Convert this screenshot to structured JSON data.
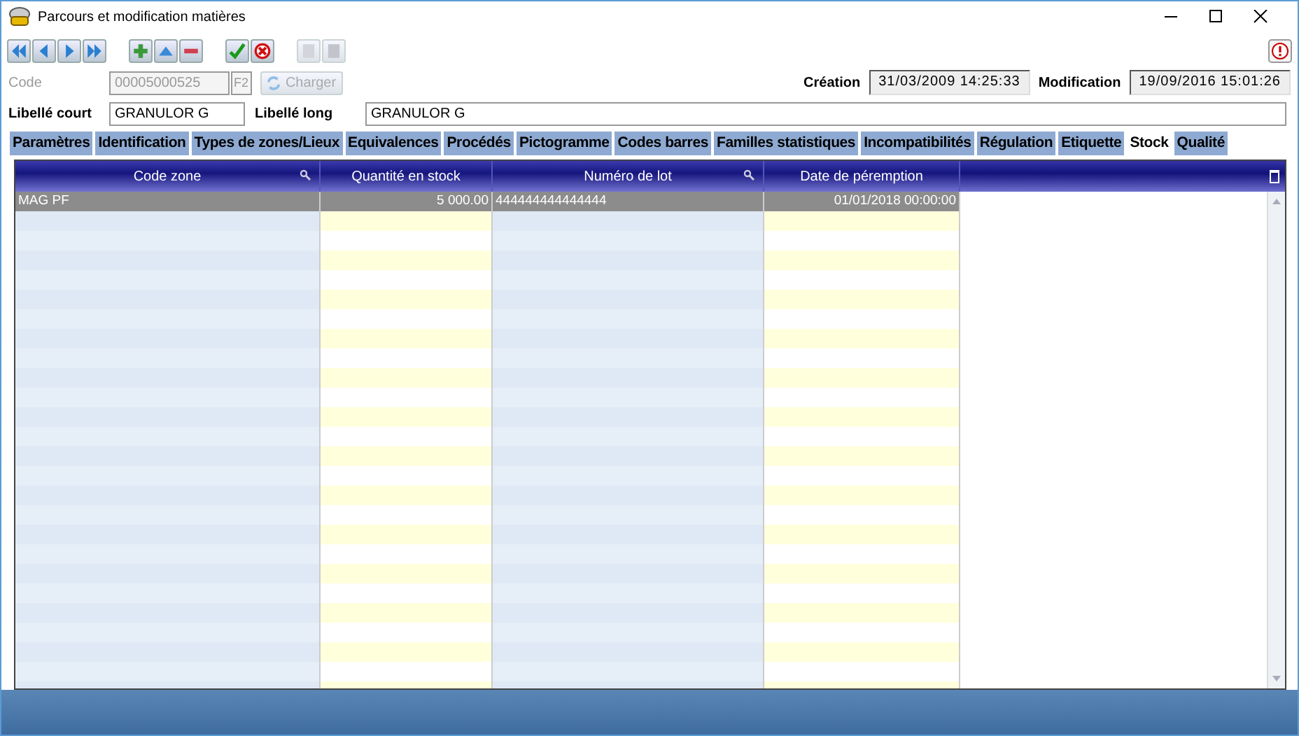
{
  "window": {
    "title": "Parcours et modification matières"
  },
  "toolbar": [
    {
      "kind": "first",
      "disabled": false
    },
    {
      "kind": "prev",
      "disabled": false
    },
    {
      "kind": "next",
      "disabled": false
    },
    {
      "kind": "last",
      "disabled": false
    },
    {
      "kind": "gap"
    },
    {
      "kind": "add",
      "disabled": false
    },
    {
      "kind": "up",
      "disabled": false
    },
    {
      "kind": "remove",
      "disabled": false
    },
    {
      "kind": "gap"
    },
    {
      "kind": "validate",
      "disabled": false
    },
    {
      "kind": "cancel",
      "disabled": false
    },
    {
      "kind": "gap"
    },
    {
      "kind": "copy",
      "disabled": true
    },
    {
      "kind": "paste",
      "disabled": true
    }
  ],
  "code": {
    "label": "Code",
    "value": "00005000525",
    "disabled": true,
    "key": "F2",
    "load_button": "Charger"
  },
  "creation": {
    "label": "Création",
    "value": "31/03/2009 14:25:33"
  },
  "modification": {
    "label": "Modification",
    "value": "19/09/2016 15:01:26"
  },
  "short_label": {
    "label": "Libellé court",
    "value": "GRANULOR G"
  },
  "long_label": {
    "label": "Libellé long",
    "value": "GRANULOR G"
  },
  "tabs": [
    {
      "label": "Paramètres",
      "selected": false
    },
    {
      "label": "Identification",
      "selected": false
    },
    {
      "label": "Types de zones/Lieux",
      "selected": false
    },
    {
      "label": "Equivalences",
      "selected": false
    },
    {
      "label": "Procédés",
      "selected": false
    },
    {
      "label": "Pictogramme",
      "selected": false
    },
    {
      "label": "Codes barres",
      "selected": false
    },
    {
      "label": "Familles statistiques",
      "selected": false
    },
    {
      "label": "Incompatibilités",
      "selected": false
    },
    {
      "label": "Régulation",
      "selected": false
    },
    {
      "label": "Etiquette",
      "selected": false
    },
    {
      "label": "Stock",
      "selected": true
    },
    {
      "label": "Qualité",
      "selected": false
    }
  ],
  "table": {
    "columns": [
      {
        "label": "Code zone",
        "searchable": true
      },
      {
        "label": "Quantité en stock",
        "searchable": false
      },
      {
        "label": "Numéro de lot",
        "searchable": true
      },
      {
        "label": "Date de péremption",
        "searchable": false
      }
    ],
    "rows": [
      {
        "selected": true,
        "cells": [
          "MAG PF",
          "5 000.00",
          "444444444444444",
          "01/01/2018 00:00:00"
        ]
      }
    ]
  }
}
